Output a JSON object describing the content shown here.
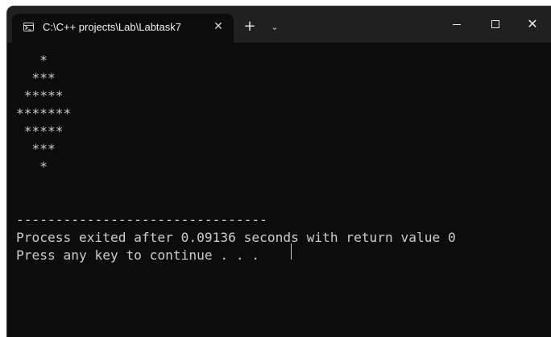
{
  "window": {
    "tab_title": "C:\\C++ projects\\Lab\\Labtask7",
    "tab_icon": "terminal-icon",
    "tab_close": "✕",
    "new_tab": "+",
    "dropdown": "⌄",
    "minimize_icon": "minimize-icon",
    "maximize_icon": "maximize-icon",
    "close": "✕"
  },
  "terminal": {
    "pattern": [
      "   *",
      "  ***",
      " *****",
      "*******",
      " *****",
      "  ***",
      "   *"
    ],
    "separator": "--------------------------------",
    "exit_message": "Process exited after 0.09136 seconds with return value 0",
    "prompt": "Press any key to continue . . . "
  }
}
